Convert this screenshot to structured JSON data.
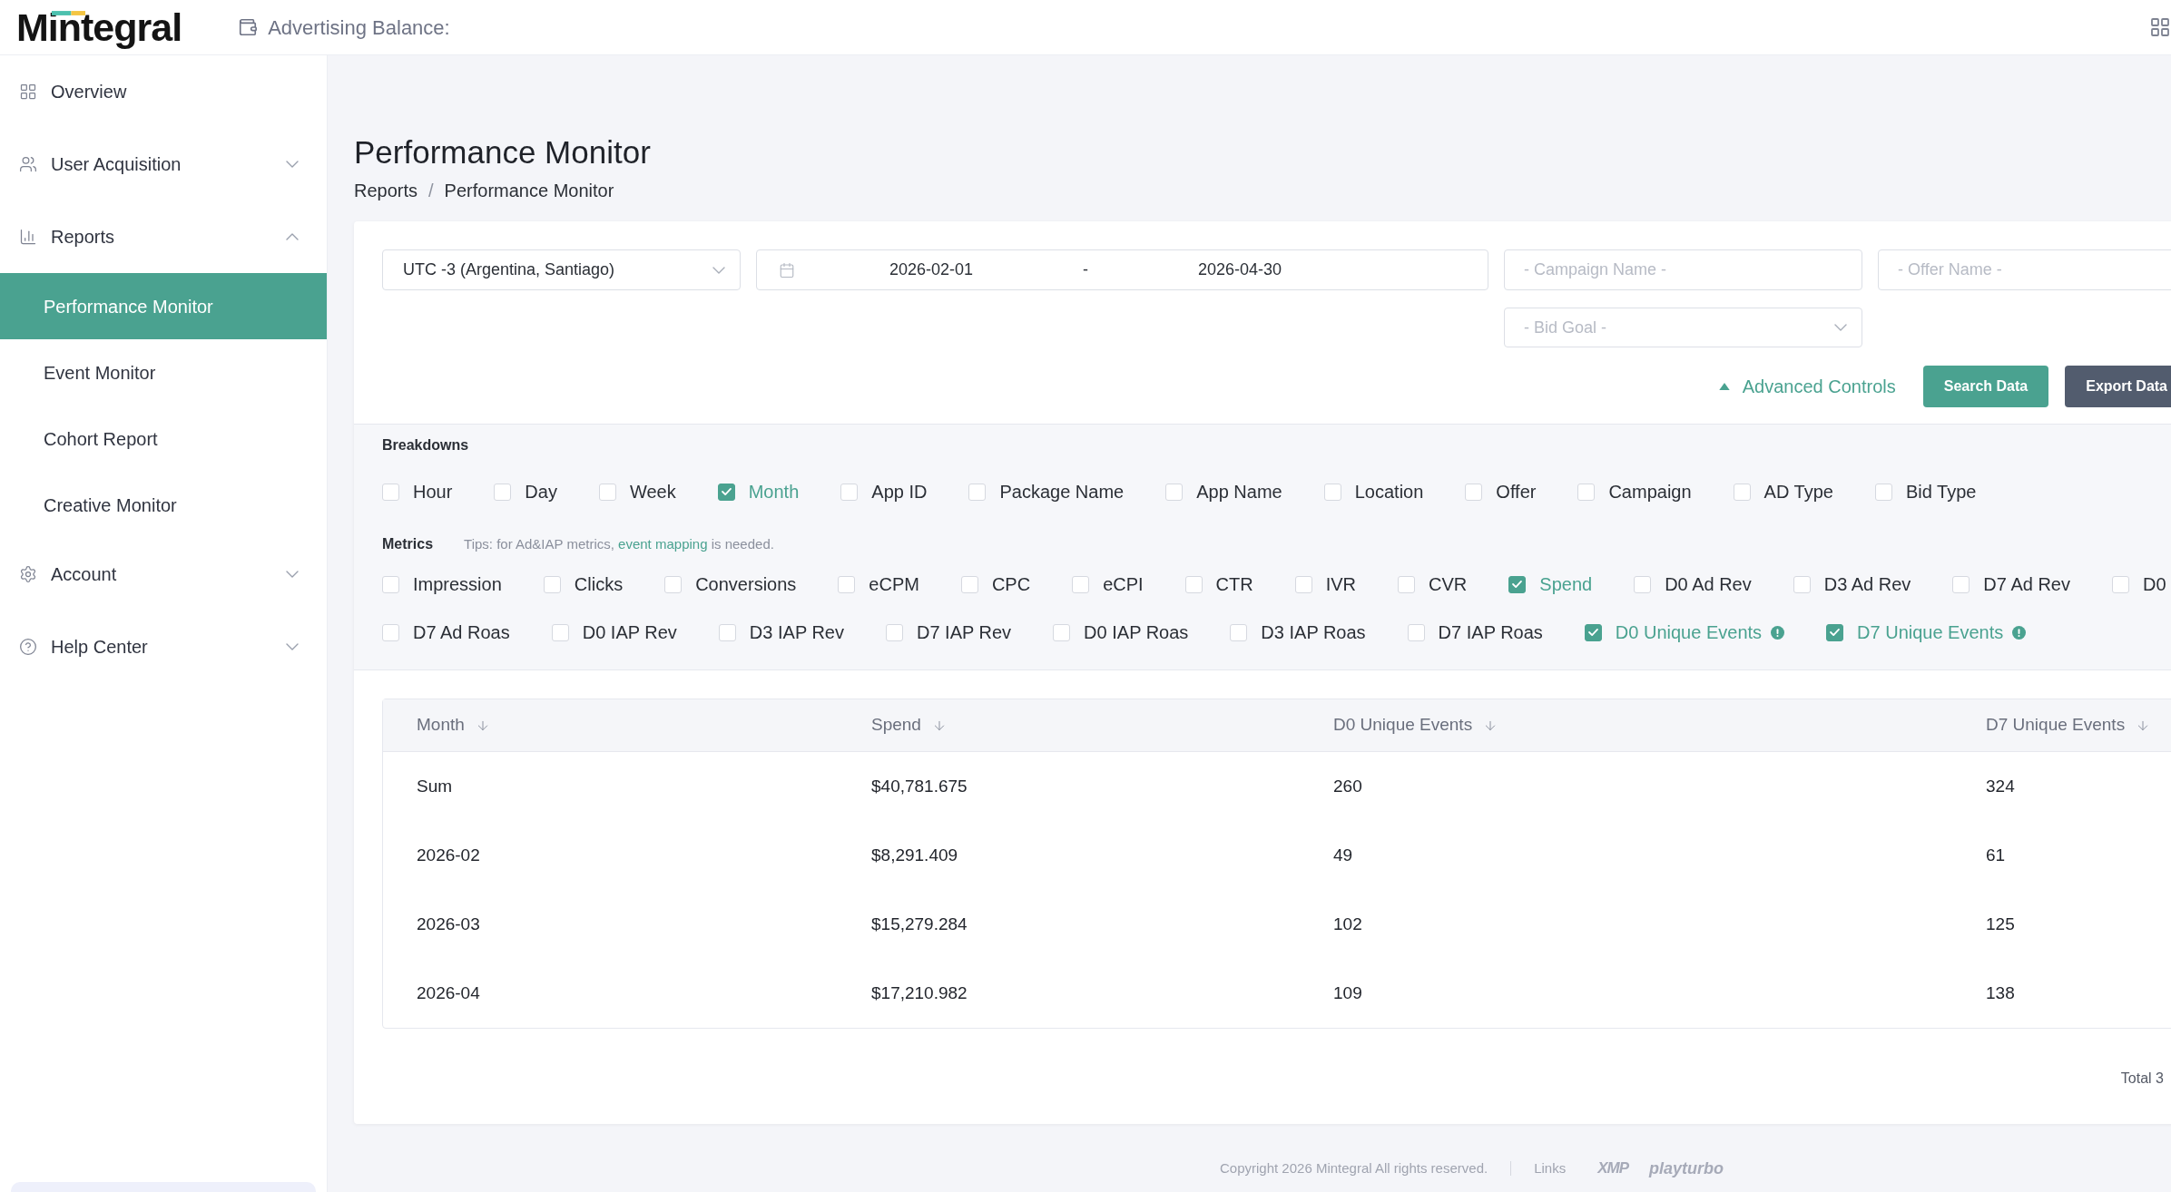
{
  "header": {
    "logo": "Mintegral",
    "balance_label": "Advertising Balance:"
  },
  "sidebar": {
    "items": [
      {
        "kind": "link",
        "label": "Overview",
        "selected": false
      },
      {
        "kind": "group",
        "label": "User Acquisition",
        "selected": false,
        "expanded": false
      },
      {
        "kind": "group",
        "label": "Reports",
        "selected": false,
        "expanded": true,
        "children": [
          {
            "label": "Performance Monitor",
            "selected": true
          },
          {
            "label": "Event Monitor",
            "selected": false
          },
          {
            "label": "Cohort Report",
            "selected": false
          },
          {
            "label": "Creative Monitor",
            "selected": false
          }
        ]
      },
      {
        "kind": "group",
        "label": "Account",
        "selected": false,
        "expanded": false
      },
      {
        "kind": "group",
        "label": "Help Center",
        "selected": false,
        "expanded": false
      }
    ]
  },
  "page": {
    "title": "Performance Monitor",
    "breadcrumb": {
      "items": [
        "Reports",
        "Performance Monitor"
      ],
      "separator": "/"
    }
  },
  "filters": {
    "timezone": {
      "value": "UTC -3 (Argentina, Santiago)"
    },
    "date_range": {
      "start": "2026-02-01",
      "separator": "-",
      "end": "2026-04-30"
    },
    "campaign_name": {
      "placeholder": "- Campaign Name -"
    },
    "offer_name": {
      "placeholder": "- Offer Name -"
    },
    "bid_goal": {
      "placeholder": "- Bid Goal -"
    },
    "advanced_controls": {
      "label": "Advanced Controls",
      "expanded": true
    },
    "buttons": [
      {
        "kind": "primary",
        "label": "Search Data"
      },
      {
        "kind": "secondary",
        "label": "Export Data"
      }
    ]
  },
  "breakdowns": {
    "label": "Breakdowns",
    "options": [
      {
        "label": "Hour",
        "checked": false
      },
      {
        "label": "Day",
        "checked": false
      },
      {
        "label": "Week",
        "checked": false
      },
      {
        "label": "Month",
        "checked": true
      },
      {
        "label": "App ID",
        "checked": false
      },
      {
        "label": "Package Name",
        "checked": false
      },
      {
        "label": "App Name",
        "checked": false
      },
      {
        "label": "Location",
        "checked": false
      },
      {
        "label": "Offer",
        "checked": false
      },
      {
        "label": "Campaign",
        "checked": false
      },
      {
        "label": "AD Type",
        "checked": false
      },
      {
        "label": "Bid Type",
        "checked": false
      }
    ]
  },
  "metrics": {
    "label": "Metrics",
    "tip": {
      "before": "Tips: for Ad&IAP metrics, ",
      "link": "event mapping",
      "after": " is needed."
    },
    "options": [
      {
        "label": "Impression",
        "checked": false,
        "info": false
      },
      {
        "label": "Clicks",
        "checked": false,
        "info": false
      },
      {
        "label": "Conversions",
        "checked": false,
        "info": false
      },
      {
        "label": "eCPM",
        "checked": false,
        "info": false
      },
      {
        "label": "CPC",
        "checked": false,
        "info": false
      },
      {
        "label": "eCPI",
        "checked": false,
        "info": false
      },
      {
        "label": "CTR",
        "checked": false,
        "info": false
      },
      {
        "label": "IVR",
        "checked": false,
        "info": false
      },
      {
        "label": "CVR",
        "checked": false,
        "info": false
      },
      {
        "label": "Spend",
        "checked": true,
        "info": false
      },
      {
        "label": "D0 Ad Rev",
        "checked": false,
        "info": false
      },
      {
        "label": "D3 Ad Rev",
        "checked": false,
        "info": false
      },
      {
        "label": "D7 Ad Rev",
        "checked": false,
        "info": false
      },
      {
        "label": "D0",
        "checked": false,
        "info": false
      },
      {
        "label": "D7 Ad Roas",
        "checked": false,
        "info": false
      },
      {
        "label": "D0 IAP Rev",
        "checked": false,
        "info": false
      },
      {
        "label": "D3 IAP Rev",
        "checked": false,
        "info": false
      },
      {
        "label": "D7 IAP Rev",
        "checked": false,
        "info": false
      },
      {
        "label": "D0 IAP Roas",
        "checked": false,
        "info": false
      },
      {
        "label": "D3 IAP Roas",
        "checked": false,
        "info": false
      },
      {
        "label": "D7 IAP Roas",
        "checked": false,
        "info": false
      },
      {
        "label": "D0 Unique Events",
        "checked": true,
        "info": true
      },
      {
        "label": "D7 Unique Events",
        "checked": true,
        "info": true
      }
    ]
  },
  "table": {
    "columns": [
      "Month",
      "Spend",
      "D0 Unique Events",
      "D7 Unique Events"
    ],
    "rows": [
      [
        "Sum",
        "$40,781.675",
        "260",
        "324"
      ],
      [
        "2026-02",
        "$8,291.409",
        "49",
        "61"
      ],
      [
        "2026-03",
        "$15,279.284",
        "102",
        "125"
      ],
      [
        "2026-04",
        "$17,210.982",
        "109",
        "138"
      ]
    ]
  },
  "pagination": {
    "total": "Total 3"
  },
  "footer": {
    "copyright": "Copyright 2026 Mintegral All rights reserved.",
    "links_label": "Links",
    "logos": [
      "XMP",
      "playturbo"
    ]
  }
}
